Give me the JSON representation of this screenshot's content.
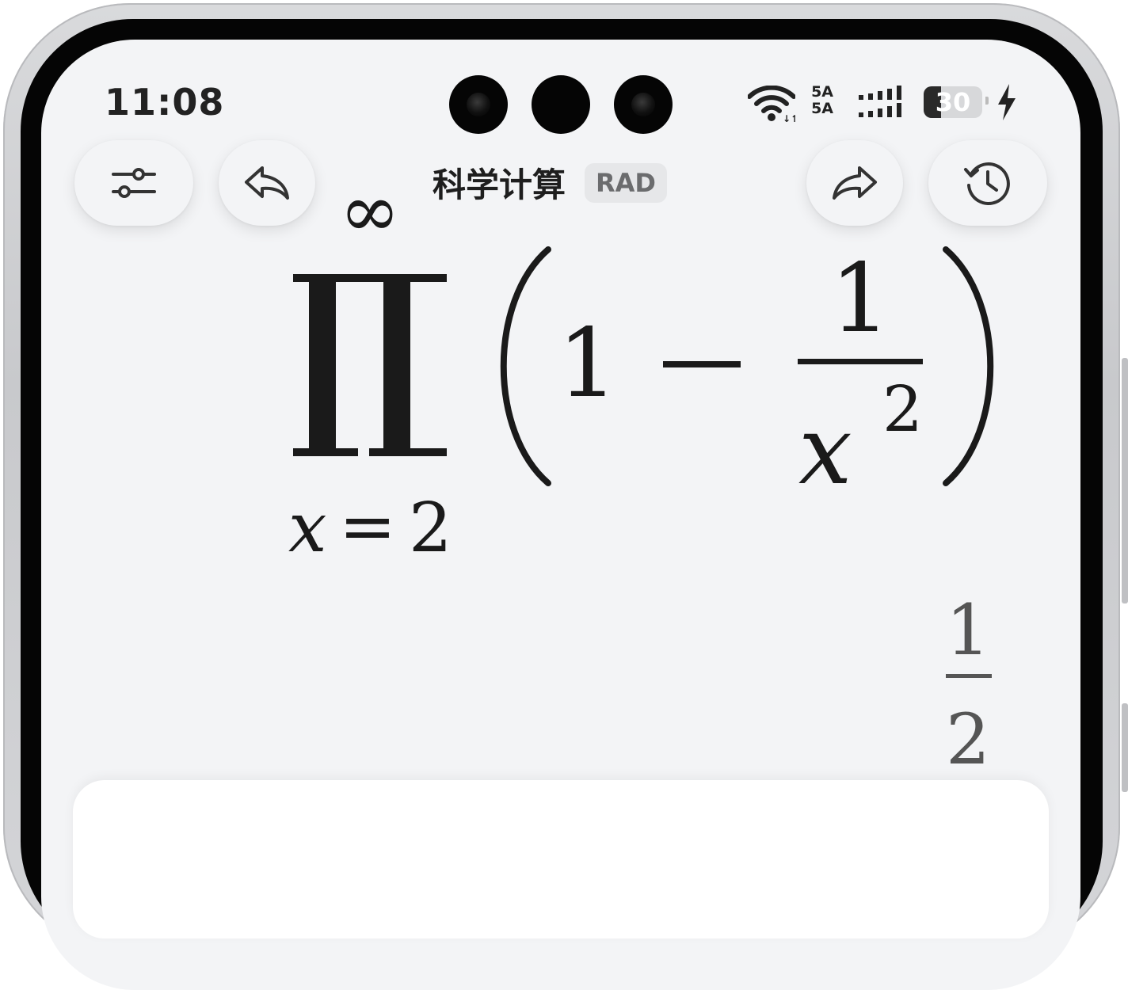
{
  "status_bar": {
    "time": "11:08",
    "network_1": "5A",
    "network_2": "5A",
    "battery": "30",
    "battery_level": 0.3
  },
  "toolbar": {
    "title": "科学计算",
    "angle_mode": "RAD",
    "icons": {
      "settings": "sliders-icon",
      "undo": "undo-icon",
      "redo": "redo-icon",
      "history": "history-icon"
    }
  },
  "expression": {
    "operator": "∏",
    "upper_limit": "∞",
    "lower_variable": "x",
    "lower_equals": "=",
    "lower_start": "2",
    "open_paren": "(",
    "term_one": "1",
    "minus": "−",
    "numerator": "1",
    "denominator_base": "x",
    "denominator_exponent": "2",
    "close_paren": ")"
  },
  "result": {
    "numerator": "1",
    "denominator": "2"
  }
}
